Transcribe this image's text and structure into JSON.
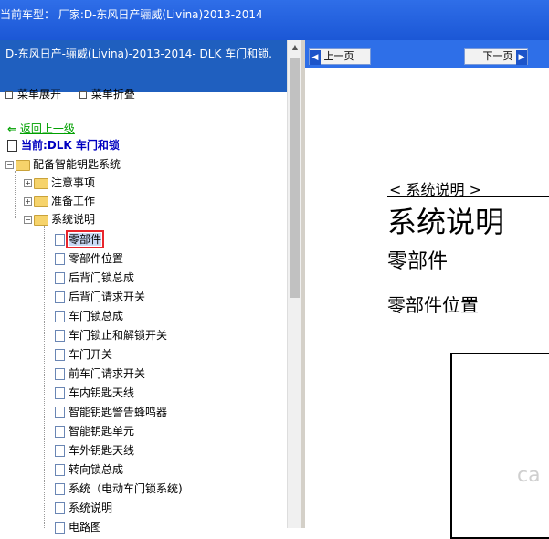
{
  "top_bar": {
    "title": "当前车型： 厂家:D-东风日产骊威(Livina)2013-2014"
  },
  "left_panel": {
    "header": "D-东风日产-骊威(Livina)-2013-2014- DLK 车门和锁.",
    "expand_all": "菜单展开",
    "collapse_all": "菜单折叠",
    "back_link": "返回上一级",
    "current": "当前:DLK 车门和锁",
    "tree": {
      "root": "配备智能钥匙系统",
      "folders": [
        "注意事项",
        "准备工作",
        "系统说明"
      ],
      "items": [
        "零部件",
        "零部件位置",
        "后背门锁总成",
        "后背门请求开关",
        "车门锁总成",
        "车门锁止和解锁开关",
        "车门开关",
        "前车门请求开关",
        "车内钥匙天线",
        "智能钥匙警告蜂鸣器",
        "智能钥匙单元",
        "车外钥匙天线",
        "转向锁总成",
        "系统（电动车门锁系统)",
        "系统说明",
        "电路图"
      ]
    }
  },
  "right_panel": {
    "prev_label": "上一页",
    "next_label": "下一页",
    "section_header": "< 系统说明 >",
    "title": "系统说明",
    "heading_parts": "零部件",
    "heading_position": "零部件位置",
    "watermark": "ca"
  }
}
